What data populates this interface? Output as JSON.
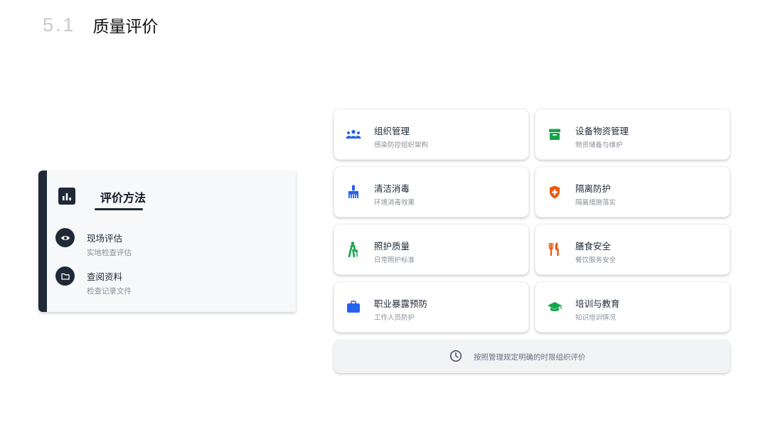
{
  "header": {
    "section_number": "5.1",
    "title": "质量评价"
  },
  "methods": {
    "title": "评价方法",
    "header_icon": "bar-chart-icon",
    "items": [
      {
        "title": "现场评估",
        "subtitle": "实地检查评估",
        "icon": "eye-icon"
      },
      {
        "title": "查阅资料",
        "subtitle": "检查记录文件",
        "icon": "folder-icon"
      }
    ]
  },
  "features": [
    {
      "title": "组织管理",
      "subtitle": "感染防控组织架构",
      "icon": "people-icon",
      "color": "#2563eb"
    },
    {
      "title": "设备物资管理",
      "subtitle": "物资储备与维护",
      "icon": "archive-box-icon",
      "color": "#16a34a"
    },
    {
      "title": "清洁消毒",
      "subtitle": "环境消毒效果",
      "icon": "cleaning-brush-icon",
      "color": "#2563eb"
    },
    {
      "title": "隔离防护",
      "subtitle": "隔离措施落实",
      "icon": "shield-plus-icon",
      "color": "#ea580c"
    },
    {
      "title": "照护质量",
      "subtitle": "日常照护标准",
      "icon": "walking-cane-icon",
      "color": "#16a34a"
    },
    {
      "title": "膳食安全",
      "subtitle": "餐饮服务安全",
      "icon": "utensils-icon",
      "color": "#ea580c"
    },
    {
      "title": "职业暴露预防",
      "subtitle": "工作人员防护",
      "icon": "briefcase-icon",
      "color": "#2563eb"
    },
    {
      "title": "培训与教育",
      "subtitle": "知识培训情况",
      "icon": "graduation-cap-icon",
      "color": "#16a34a"
    }
  ],
  "note": {
    "text": "按照管理规定明确的时限组织评价",
    "icon": "clock-icon"
  }
}
